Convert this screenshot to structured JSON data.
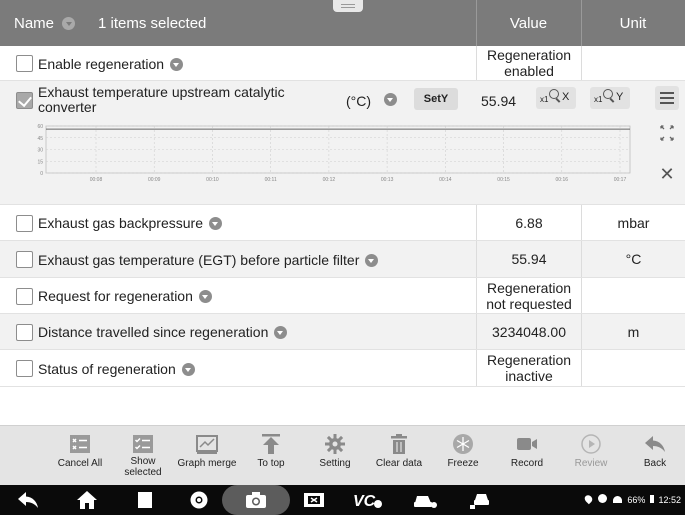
{
  "header": {
    "name_label": "Name",
    "selection_text": "1 items selected",
    "value_label": "Value",
    "unit_label": "Unit"
  },
  "rows": [
    {
      "label": "Enable regeneration",
      "value": "Regeneration enabled",
      "unit": "",
      "checked": false
    },
    {
      "label": "Exhaust temperature upstream catalytic converter",
      "value": "55.94",
      "unit": "(°C)",
      "checked": true,
      "set_label": "SetY",
      "zoom_x_label": "X",
      "zoom_y_label": "Y",
      "zoom_factor": "x1"
    },
    {
      "label": "Exhaust gas backpressure",
      "value": "6.88",
      "unit": "mbar",
      "checked": false
    },
    {
      "label": "Exhaust gas temperature (EGT) before particle filter",
      "value": "55.94",
      "unit": "°C",
      "checked": false
    },
    {
      "label": "Request for regeneration",
      "value": "Regeneration not requested",
      "unit": "",
      "checked": false
    },
    {
      "label": "Distance travelled since regeneration",
      "value": "3234048.00",
      "unit": "m",
      "checked": false
    },
    {
      "label": "Status of regeneration",
      "value": "Regeneration inactive",
      "unit": "",
      "checked": false
    }
  ],
  "chart_data": {
    "type": "line",
    "y_ticks": [
      "60",
      "45",
      "30",
      "15",
      "0"
    ],
    "x_ticks": [
      "00:08",
      "00:09",
      "00:10",
      "00:11",
      "00:12",
      "00:13",
      "00:14",
      "00:15",
      "00:16",
      "00:17"
    ],
    "ylim": [
      0,
      60
    ],
    "series": [
      {
        "values": [
          55.94,
          55.94,
          55.94,
          55.94,
          55.94,
          55.94,
          55.94,
          55.94,
          55.94,
          55.94
        ]
      }
    ]
  },
  "toolbar": {
    "items": [
      {
        "label": "Cancel All",
        "icon": "cancel-all-icon"
      },
      {
        "label": "Show selected",
        "icon": "show-selected-icon"
      },
      {
        "label": "Graph merge",
        "icon": "graph-merge-icon"
      },
      {
        "label": "To top",
        "icon": "to-top-icon"
      },
      {
        "label": "Setting",
        "icon": "gear-icon"
      },
      {
        "label": "Clear data",
        "icon": "trash-icon"
      },
      {
        "label": "Freeze",
        "icon": "snowflake-icon"
      },
      {
        "label": "Record",
        "icon": "video-icon"
      },
      {
        "label": "Review",
        "icon": "play-icon"
      },
      {
        "label": "Back",
        "icon": "back-arrow-icon"
      }
    ]
  },
  "navbar": {
    "status_text": "66%",
    "time_text": "12:52"
  }
}
